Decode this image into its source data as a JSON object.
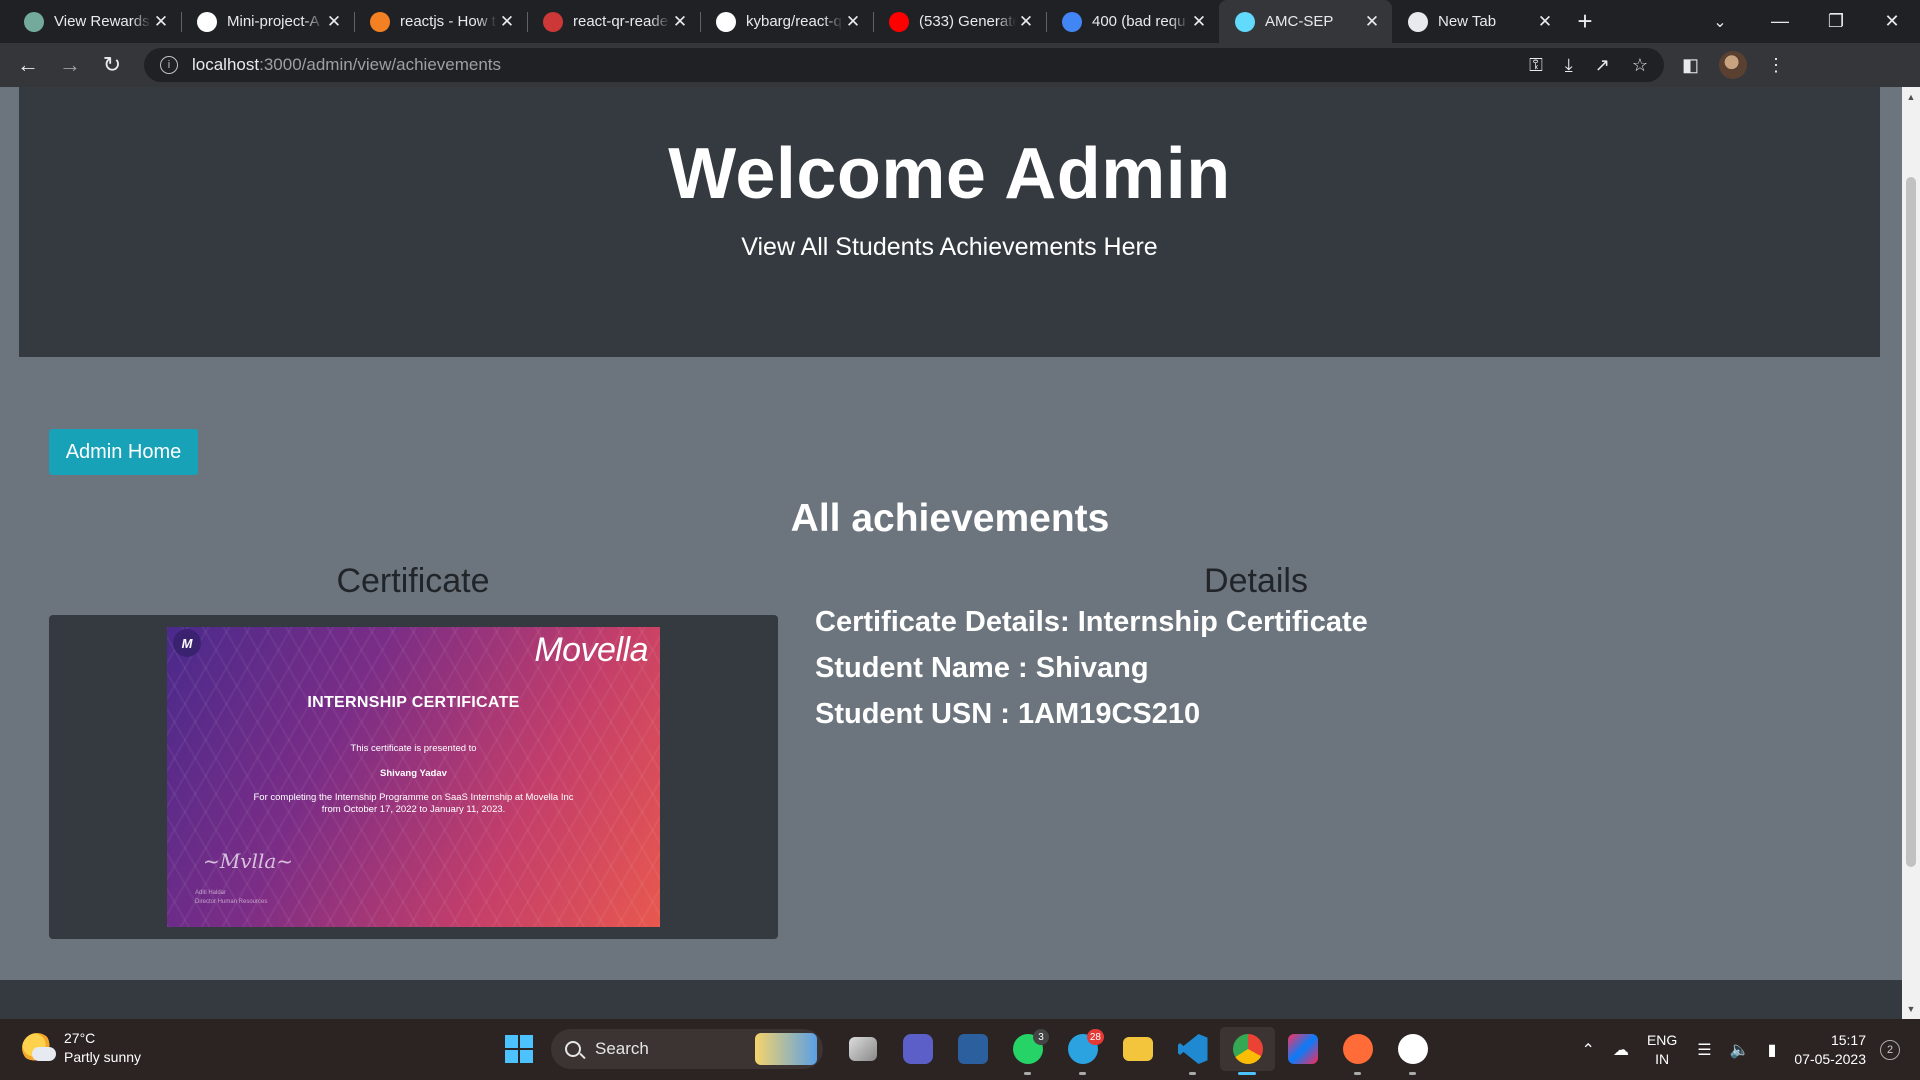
{
  "browser": {
    "tabs": [
      {
        "label": "View Rewards",
        "icon": "openai-icon",
        "color": "#74aa9c"
      },
      {
        "label": "Mini-project-A",
        "icon": "github-icon",
        "color": "#ffffff"
      },
      {
        "label": "reactjs - How t",
        "icon": "stackoverflow-icon",
        "color": "#f48024"
      },
      {
        "label": "react-qr-reade",
        "icon": "npm-icon",
        "color": "#cb3837"
      },
      {
        "label": "kybarg/react-q",
        "icon": "github-icon",
        "color": "#ffffff"
      },
      {
        "label": "(533) Generate",
        "icon": "youtube-icon",
        "color": "#ff0000"
      },
      {
        "label": "400 (bad requ",
        "icon": "google-icon",
        "color": "#4285f4"
      },
      {
        "label": "AMC-SEP",
        "icon": "react-icon",
        "color": "#61dafb",
        "active": true
      },
      {
        "label": "New Tab",
        "icon": "chrome-icon",
        "color": "#e8eaed"
      }
    ],
    "url_host": "localhost",
    "url_path": ":3000/admin/view/achievements"
  },
  "page": {
    "hero_title": "Welcome Admin",
    "hero_subtitle": "View All Students Achievements Here",
    "admin_home_label": "Admin Home",
    "section_title": "All achievements",
    "col_certificate": "Certificate",
    "col_details": "Details"
  },
  "certificate": {
    "brand": "Movella",
    "title": "INTERNSHIP CERTIFICATE",
    "presented": "This certificate is presented to",
    "recipient": "Shivang Yadav",
    "body1": "For completing the Internship Programme on SaaS Internship at Movella Inc",
    "body2": "from October 17, 2022 to January 11, 2023.",
    "signer_name": "Aditi Haldar",
    "signer_role": "Director Human Resources"
  },
  "details": {
    "cert_details": "Certificate Details: Internship Certificate",
    "student_name": "Student Name : Shivang",
    "student_usn": "Student USN : 1AM19CS210"
  },
  "taskbar": {
    "temp": "27°C",
    "weather": "Partly sunny",
    "search": "Search",
    "whatsapp_badge": "3",
    "telegram_badge": "28",
    "lang1": "ENG",
    "lang2": "IN",
    "time": "15:17",
    "date": "07-05-2023",
    "notifications": "2"
  },
  "colors": {
    "jumbotron": "#343a40",
    "page_bg": "#6c757d",
    "info_button": "#17a2b8"
  }
}
